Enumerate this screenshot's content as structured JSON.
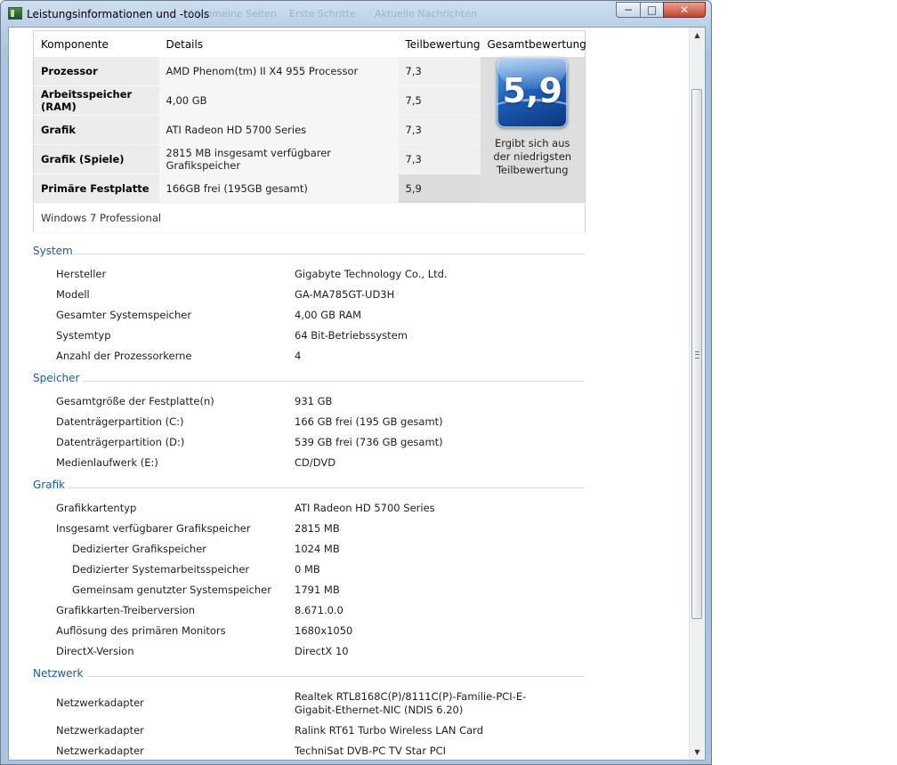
{
  "window": {
    "title": "Leistungsinformationen und -tools",
    "background_tabs": [
      "Allgemeine Seiten",
      "Erste Schritte",
      "Aktuelle Nachrichten"
    ]
  },
  "controls": {
    "minimize": "−",
    "maximize": "□",
    "close": "✕"
  },
  "scores": {
    "headers": {
      "component": "Komponente",
      "details": "Details",
      "subscore": "Teilbewertung",
      "overall": "Gesamtbewertung"
    },
    "rows": [
      {
        "component": "Prozessor",
        "details": "AMD Phenom(tm) II X4 955 Processor",
        "subscore": "7,3"
      },
      {
        "component": "Arbeitsspeicher (RAM)",
        "details": "4,00 GB",
        "subscore": "7,5"
      },
      {
        "component": "Grafik",
        "details": "ATI Radeon HD 5700 Series",
        "subscore": "7,3"
      },
      {
        "component": "Grafik (Spiele)",
        "details": "2815 MB insgesamt verfügbarer Grafikspeicher",
        "subscore": "7,3"
      },
      {
        "component": "Primäre Festplatte",
        "details": "166GB frei (195GB gesamt)",
        "subscore": "5,9"
      }
    ],
    "overall": {
      "score": "5,9",
      "caption": "Ergibt sich aus der niedrigsten Teilbewertung"
    },
    "os": "Windows 7 Professional"
  },
  "sections": [
    {
      "title": "System",
      "items": [
        {
          "label": "Hersteller",
          "value": "Gigabyte Technology Co., Ltd."
        },
        {
          "label": "Modell",
          "value": "GA-MA785GT-UD3H"
        },
        {
          "label": "Gesamter Systemspeicher",
          "value": "4,00 GB RAM"
        },
        {
          "label": "Systemtyp",
          "value": "64 Bit-Betriebssystem"
        },
        {
          "label": "Anzahl der Prozessorkerne",
          "value": "4"
        }
      ]
    },
    {
      "title": "Speicher",
      "items": [
        {
          "label": "Gesamtgröße der Festplatte(n)",
          "value": "931 GB"
        },
        {
          "label": "Datenträgerpartition (C:)",
          "value": "166 GB frei (195 GB gesamt)"
        },
        {
          "label": "Datenträgerpartition (D:)",
          "value": "539 GB frei (736 GB gesamt)"
        },
        {
          "label": "Medienlaufwerk (E:)",
          "value": "CD/DVD"
        }
      ]
    },
    {
      "title": "Grafik",
      "items": [
        {
          "label": "Grafikkartentyp",
          "value": "ATI Radeon HD 5700 Series"
        },
        {
          "label": "Insgesamt verfügbarer Grafikspeicher",
          "value": "2815 MB"
        },
        {
          "label": "Dedizierter Grafikspeicher",
          "value": "1024 MB"
        },
        {
          "label": "Dedizierter Systemarbeitsspeicher",
          "value": "0 MB"
        },
        {
          "label": "Gemeinsam genutzter Systemspeicher",
          "value": "1791 MB"
        },
        {
          "label": "Grafikkarten-Treiberversion",
          "value": "8.671.0.0"
        },
        {
          "label": "Auflösung des primären Monitors",
          "value": "1680x1050"
        },
        {
          "label": "DirectX-Version",
          "value": "DirectX 10"
        }
      ]
    },
    {
      "title": "Netzwerk",
      "items": [
        {
          "label": "Netzwerkadapter",
          "value": "Realtek RTL8168C(P)/8111C(P)-Familie-PCI-E-Gigabit-Ethernet-NIC (NDIS 6.20)"
        },
        {
          "label": "Netzwerkadapter",
          "value": "Ralink RT61 Turbo Wireless LAN Card"
        },
        {
          "label": "Netzwerkadapter",
          "value": "TechniSat DVB-PC TV Star PCI"
        }
      ]
    }
  ]
}
